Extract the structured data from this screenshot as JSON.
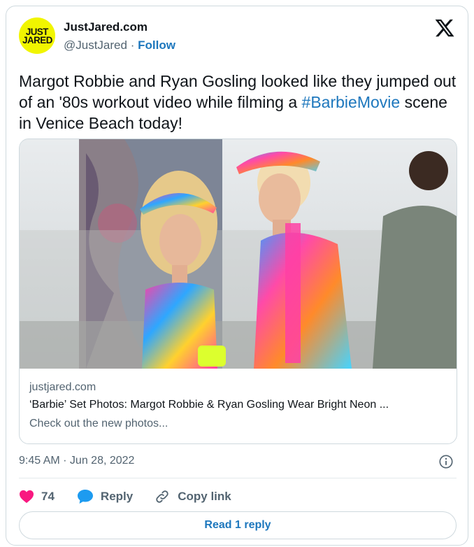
{
  "author": {
    "avatar_text_line1": "JUST",
    "avatar_text_line2": "JARED",
    "name": "JustJared.com",
    "handle": "@JustJared",
    "separator": "·",
    "follow_label": "Follow"
  },
  "tweet": {
    "text_before": "Margot Robbie and Ryan Gosling looked like they jumped out of an '80s workout video while filming a ",
    "hashtag": "#BarbieMovie",
    "text_after": " scene in Venice Beach today!"
  },
  "link_card": {
    "domain": "justjared.com",
    "title": "‘Barbie’ Set Photos: Margot Robbie & Ryan Gosling Wear Bright Neon ...",
    "description": "Check out the new photos..."
  },
  "timestamp": "9:45 AM · Jun 28, 2022",
  "actions": {
    "like_count": "74",
    "reply_label": "Reply",
    "copy_label": "Copy link"
  },
  "read_reply_label": "Read 1 reply",
  "colors": {
    "accent": "#1d77bd",
    "heart": "#f91880",
    "avatar_bg": "#f1f500",
    "muted": "#536471"
  },
  "icons": [
    "x-logo-icon",
    "info-icon",
    "heart-icon",
    "reply-bubble-icon",
    "link-icon"
  ]
}
